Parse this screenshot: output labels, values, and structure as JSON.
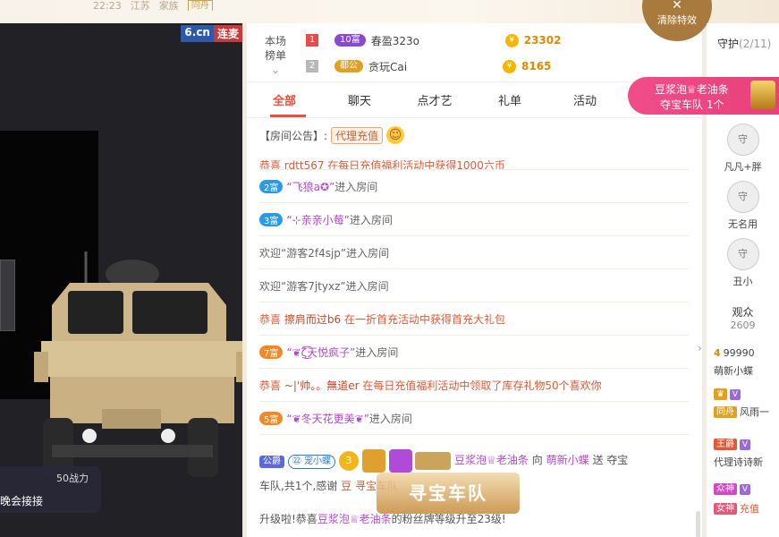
{
  "top": {
    "time": "22:23",
    "location": "江苏",
    "family": "家族",
    "tag": "同舟"
  },
  "video": {
    "logo_a": "6.cn",
    "logo_b": "连麦",
    "power_text": "50战力",
    "pk_text": "晚会接接"
  },
  "rank": {
    "label_line1": "本场",
    "label_line2": "榜单",
    "label_arrow": "⌄",
    "rows": [
      {
        "num": "1",
        "num_color": "#e64c4c",
        "badge": "10富",
        "badge_color": "#8a4ad0",
        "name": "春盈323o",
        "coin": "¥",
        "amount": "23302"
      },
      {
        "num": "2",
        "num_color": "#b8b8b8",
        "badge": "都公",
        "badge_color": "#e0a020",
        "name": "贪玩Cai",
        "coin": "¥",
        "amount": "8165"
      }
    ]
  },
  "tabs": [
    "全部",
    "聊天",
    "点才艺",
    "礼单",
    "活动"
  ],
  "notice": {
    "label": "【房间公告】:",
    "agent": "代理充值",
    "emoji": "☺"
  },
  "messages": {
    "m0": {
      "text": "恭喜 rdtt567 在每日充值福利活动中获得1000六币"
    },
    "m1": {
      "lv": "2富",
      "user": "“飞狼a✪”",
      "text": "进入房间"
    },
    "m2": {
      "lv": "3富",
      "user": "“⊹亲亲小莓”",
      "text": "进入房间"
    },
    "m3": {
      "text": "欢迎“游客2f4sjp”进入房间"
    },
    "m4": {
      "text": "欢迎“游客7jtyxz”进入房间"
    },
    "m5": {
      "prefix": "恭喜",
      "who": "擦肩而过b6",
      "text": "在一折首充活动中获得首充大礼包"
    },
    "m6": {
      "lv": "7富",
      "user": "“❦ζ͜͡天悦疯子”",
      "text": "进入房间"
    },
    "m7": {
      "prefix": "恭喜",
      "who": "~|'帅。。無道er",
      "text": "在每日充值福利活动中领取了库存礼物50个喜欢你"
    },
    "m8": {
      "lv": "5富",
      "user": "“❦冬天花更美❦”",
      "text": "进入房间"
    }
  },
  "gift": {
    "badge1": "公爵",
    "badge2": "㉒ 宠小蝶",
    "star": "3",
    "sender": "豆浆泡♕老油条",
    "to": "向",
    "receiver": "萌新小蝶",
    "send": "送",
    "gift": "夺宝",
    "line2a": "车队,共1个,感谢",
    "line2b": "豆",
    "line2c": "寻宝车队 "
  },
  "treasure_overlay": "寻宝车队",
  "upgrade": {
    "a": "升级啦!恭喜",
    "user": "豆浆泡♕老油条",
    "b": "的粉丝牌等级升至23级!"
  },
  "clear_fx": {
    "x": "✕",
    "label": "清除特效"
  },
  "banner": {
    "line1": "豆浆泡♕老油条",
    "line2": "夺宝车队 1个"
  },
  "guard": {
    "title": "守护",
    "count": "(2/11)",
    "items": [
      {
        "name": "凡凡+胖",
        "mark": "守"
      },
      {
        "name": "无名用",
        "mark": "守"
      },
      {
        "name": "丑小",
        "mark": "守"
      }
    ]
  },
  "audience": {
    "title": "观众",
    "count": "2609",
    "rows": [
      {
        "lv": "4",
        "id": "99990",
        "name": "萌新小蝶"
      },
      {
        "badge": "同舟",
        "name": "风雨一"
      },
      {
        "badge": "王爵",
        "name": "代理诗诗新"
      },
      {
        "badge": "众神",
        "name": ""
      },
      {
        "badge": "女神",
        "name": "充值"
      }
    ]
  }
}
